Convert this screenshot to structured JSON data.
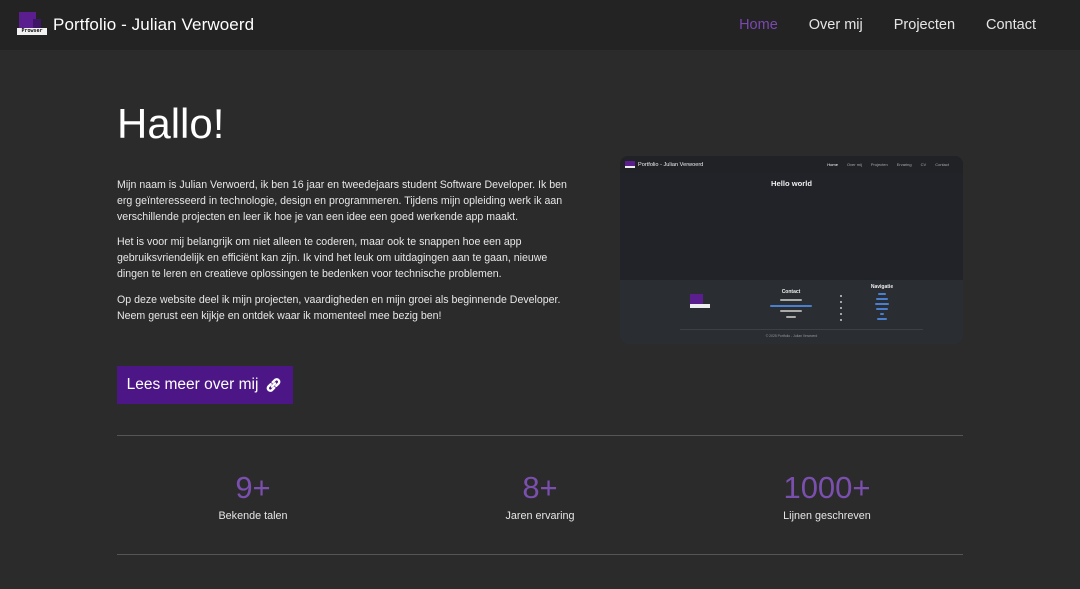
{
  "navbar": {
    "logo_text": "Prowser",
    "brand": "Portfolio - Julian Verwoerd",
    "links": [
      {
        "label": "Home",
        "active": true
      },
      {
        "label": "Over mij",
        "active": false
      },
      {
        "label": "Projecten",
        "active": false
      },
      {
        "label": "Contact",
        "active": false
      }
    ]
  },
  "hero": {
    "title": "Hallo!",
    "paragraphs": [
      "Mijn naam is Julian Verwoerd, ik ben 16 jaar en tweedejaars student Software Developer. Ik ben erg geïnteresseerd in technologie, design en programmeren. Tijdens mijn opleiding werk ik aan verschillende projecten en leer ik hoe je van een idee een goed werkende app maakt.",
      "Het is voor mij belangrijk om niet alleen te coderen, maar ook te snappen hoe een app gebruiksvriendelijk en efficiënt kan zijn. Ik vind het leuk om uitdagingen aan te gaan, nieuwe dingen te leren en creatieve oplossingen te bedenken voor technische problemen.",
      "Op deze website deel ik mijn projecten, vaardigheden en mijn groei als beginnende Developer. Neem gerust een kijkje en ontdek waar ik momenteel mee bezig ben!"
    ],
    "cta_label": "Lees meer over mij"
  },
  "preview": {
    "brand": "Portfolio - Julian Verwoerd",
    "links": [
      "Home",
      "Over mij",
      "Projecten",
      "Ervaring",
      "CV",
      "Contact"
    ],
    "hello": "Hello world",
    "contact_heading": "Contact",
    "navigation_heading": "Navigatie",
    "copyright": "© 2025 Portfolio - Julian Verwoerd"
  },
  "stats": [
    {
      "number": "9+",
      "label": "Bekende talen"
    },
    {
      "number": "8+",
      "label": "Jaren ervaring"
    },
    {
      "number": "1000+",
      "label": "Lijnen geschreven"
    }
  ],
  "colors": {
    "background": "#2b2b2b",
    "navbar": "#232323",
    "accent": "#7a48b0",
    "button": "#4c1686"
  }
}
